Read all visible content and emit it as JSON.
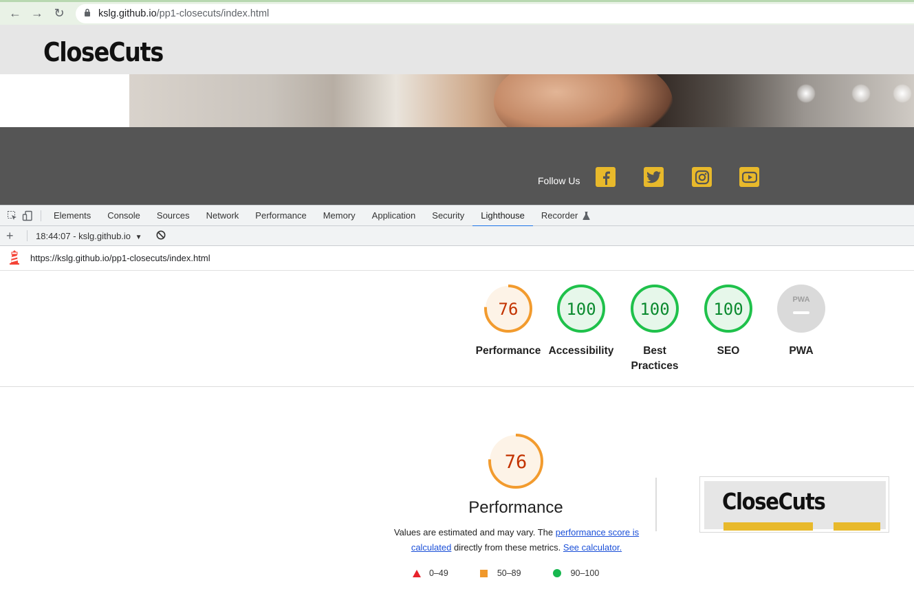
{
  "browser": {
    "url_host": "kslg.github.io",
    "url_path": "/pp1-closecuts/index.html"
  },
  "site": {
    "logo": "CloseCuts",
    "follow_label": "Follow Us",
    "socials": [
      "facebook-icon",
      "twitter-icon",
      "instagram-icon",
      "youtube-icon"
    ]
  },
  "devtools": {
    "tabs": [
      "Elements",
      "Console",
      "Sources",
      "Network",
      "Performance",
      "Memory",
      "Application",
      "Security",
      "Lighthouse",
      "Recorder"
    ],
    "active_tab": "Lighthouse",
    "report_selector": "18:44:07 - kslg.github.io",
    "report_url": "https://kslg.github.io/pp1-closecuts/index.html"
  },
  "scores": [
    {
      "label": "Performance",
      "value": "76",
      "score": 0.76,
      "status": "average"
    },
    {
      "label": "Accessibility",
      "value": "100",
      "score": 1.0,
      "status": "pass"
    },
    {
      "label": "Best Practices",
      "value": "100",
      "score": 1.0,
      "status": "pass"
    },
    {
      "label": "SEO",
      "value": "100",
      "score": 1.0,
      "status": "pass"
    },
    {
      "label": "PWA",
      "value": "",
      "score": 0,
      "status": "na",
      "badge": "PWA"
    }
  ],
  "performance": {
    "value": "76",
    "score": 0.76,
    "title": "Performance",
    "desc_part1": "Values are estimated and may vary. The ",
    "desc_link1": "performance score is calculated",
    "desc_part2": " directly from these metrics. ",
    "desc_link2": "See calculator."
  },
  "thumbnail": {
    "logo": "CloseCuts"
  },
  "legend": [
    {
      "range": "0–49",
      "shape": "triangle",
      "color": "#e8222b"
    },
    {
      "range": "50–89",
      "shape": "square",
      "color": "#f0982b"
    },
    {
      "range": "90–100",
      "shape": "circle",
      "color": "#17b74f"
    }
  ],
  "colors": {
    "pass": "#0b8a2f",
    "pass_ring": "#1fc14b",
    "pass_bg": "#e6f7ea",
    "average": "#c33300",
    "average_ring": "#f29b2e",
    "average_bg": "#fdf3e7",
    "accent": "#e8b92b"
  }
}
